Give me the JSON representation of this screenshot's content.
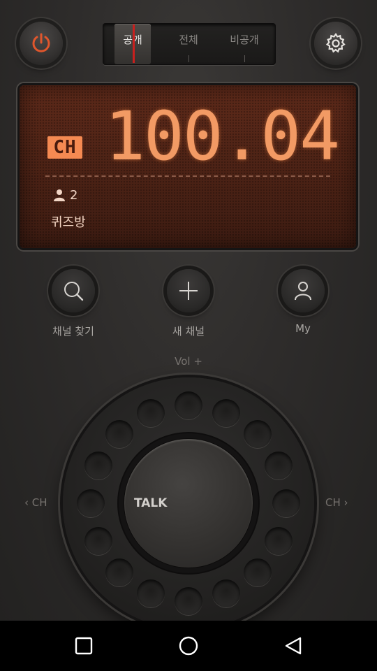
{
  "tabs": [
    {
      "label": "공개",
      "active": true
    },
    {
      "label": "전체",
      "active": false
    },
    {
      "label": "비공개",
      "active": false
    }
  ],
  "display": {
    "ch_label": "CH",
    "frequency": "100.04",
    "user_count": "2",
    "room_name": "퀴즈방"
  },
  "actions": [
    {
      "label": "채널 찾기",
      "icon": "search-icon"
    },
    {
      "label": "새 채널",
      "icon": "plus-icon"
    },
    {
      "label": "My",
      "icon": "user-icon"
    }
  ],
  "dial": {
    "vol_label": "Vol +",
    "ch_prev": "‹ CH",
    "ch_next": "CH ›",
    "talk_label": "TALK"
  },
  "colors": {
    "power_accent": "#e0562c",
    "display_text": "#f29a64",
    "active_tab_marker": "#c9201e"
  },
  "navbar": [
    "recent-apps-icon",
    "home-icon",
    "back-icon"
  ]
}
